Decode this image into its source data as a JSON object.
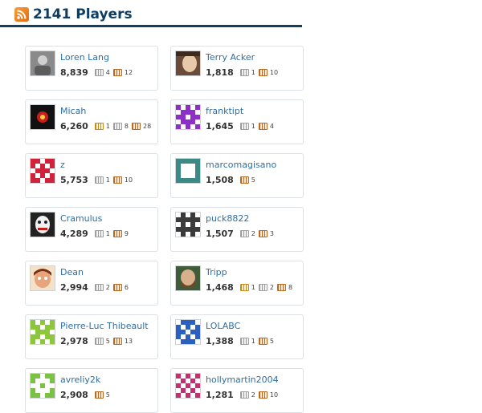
{
  "header": {
    "title": "2141 Players",
    "icon": "rss-feed-icon"
  },
  "players": [
    {
      "name": "Loren Lang",
      "rep": "8,839",
      "badges": [
        {
          "type": "silver",
          "count": "4"
        },
        {
          "type": "bronze",
          "count": "12"
        }
      ],
      "avatar": "photo-gray"
    },
    {
      "name": "Terry Acker",
      "rep": "1,818",
      "badges": [
        {
          "type": "silver",
          "count": "1"
        },
        {
          "type": "bronze",
          "count": "10"
        }
      ],
      "avatar": "photo-face"
    },
    {
      "name": "Micah",
      "rep": "6,260",
      "badges": [
        {
          "type": "gold",
          "count": "1"
        },
        {
          "type": "silver",
          "count": "8"
        },
        {
          "type": "bronze",
          "count": "28"
        }
      ],
      "avatar": "photo-red-eye"
    },
    {
      "name": "franktipt",
      "rep": "1,645",
      "badges": [
        {
          "type": "silver",
          "count": "1"
        },
        {
          "type": "bronze",
          "count": "4"
        }
      ],
      "avatar": "identicon-purple"
    },
    {
      "name": "z",
      "rep": "5,753",
      "badges": [
        {
          "type": "silver",
          "count": "1"
        },
        {
          "type": "bronze",
          "count": "10"
        }
      ],
      "avatar": "identicon-red"
    },
    {
      "name": "marcomagisano",
      "rep": "1,508",
      "badges": [
        {
          "type": "bronze",
          "count": "5"
        }
      ],
      "avatar": "identicon-teal"
    },
    {
      "name": "Cramulus",
      "rep": "4,289",
      "badges": [
        {
          "type": "silver",
          "count": "1"
        },
        {
          "type": "bronze",
          "count": "9"
        }
      ],
      "avatar": "photo-joker"
    },
    {
      "name": "puck8822",
      "rep": "1,507",
      "badges": [
        {
          "type": "silver",
          "count": "2"
        },
        {
          "type": "bronze",
          "count": "3"
        }
      ],
      "avatar": "identicon-dark"
    },
    {
      "name": "Dean",
      "rep": "2,994",
      "badges": [
        {
          "type": "silver",
          "count": "2"
        },
        {
          "type": "bronze",
          "count": "6"
        }
      ],
      "avatar": "photo-cartoon"
    },
    {
      "name": "Tripp",
      "rep": "1,468",
      "badges": [
        {
          "type": "gold",
          "count": "1"
        },
        {
          "type": "silver",
          "count": "2"
        },
        {
          "type": "bronze",
          "count": "8"
        }
      ],
      "avatar": "photo-bearded"
    },
    {
      "name": "Pierre-Luc Thibeault",
      "rep": "2,978",
      "badges": [
        {
          "type": "silver",
          "count": "5"
        },
        {
          "type": "bronze",
          "count": "13"
        }
      ],
      "avatar": "identicon-lime"
    },
    {
      "name": "LOLABC",
      "rep": "1,388",
      "badges": [
        {
          "type": "silver",
          "count": "1"
        },
        {
          "type": "bronze",
          "count": "5"
        }
      ],
      "avatar": "identicon-blue"
    },
    {
      "name": "avreliy2k",
      "rep": "2,908",
      "badges": [
        {
          "type": "bronze",
          "count": "5"
        }
      ],
      "avatar": "identicon-green"
    },
    {
      "name": "hollymartin2004",
      "rep": "1,281",
      "badges": [
        {
          "type": "silver",
          "count": "2"
        },
        {
          "type": "bronze",
          "count": "10"
        }
      ],
      "avatar": "identicon-magenta"
    }
  ],
  "colors": {
    "accent": "#0e3d63",
    "link": "#2f6ea5",
    "rule": "#133f67"
  }
}
